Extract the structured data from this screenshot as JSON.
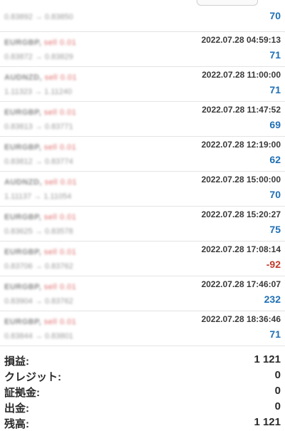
{
  "top": {
    "prices": "0.83892 → 0.83850",
    "profit": "70"
  },
  "trades": [
    {
      "symbol": "EURGBP,",
      "side": "sell 0.01",
      "prices": "0.83872 → 0.83829",
      "time": "2022.07.28 04:59:13",
      "profit": "71",
      "negative": false
    },
    {
      "symbol": "AUDNZD,",
      "side": "sell 0.01",
      "prices": "1.11323 → 1.11240",
      "time": "2022.07.28 11:00:00",
      "profit": "71",
      "negative": false
    },
    {
      "symbol": "EURGBP,",
      "side": "sell 0.01",
      "prices": "0.83813 → 0.83771",
      "time": "2022.07.28 11:47:52",
      "profit": "69",
      "negative": false
    },
    {
      "symbol": "EURGBP,",
      "side": "sell 0.01",
      "prices": "0.83812 → 0.83774",
      "time": "2022.07.28 12:19:00",
      "profit": "62",
      "negative": false
    },
    {
      "symbol": "AUDNZD,",
      "side": "sell 0.01",
      "prices": "1.11137 → 1.11054",
      "time": "2022.07.28 15:00:00",
      "profit": "70",
      "negative": false
    },
    {
      "symbol": "EURGBP,",
      "side": "sell 0.01",
      "prices": "0.83625 → 0.83578",
      "time": "2022.07.28 15:20:27",
      "profit": "75",
      "negative": false
    },
    {
      "symbol": "EURGBP,",
      "side": "sell 0.01",
      "prices": "0.83706 → 0.83762",
      "time": "2022.07.28 17:08:14",
      "profit": "-92",
      "negative": true
    },
    {
      "symbol": "EURGBP,",
      "side": "sell 0.01",
      "prices": "0.83904 → 0.83762",
      "time": "2022.07.28 17:46:07",
      "profit": "232",
      "negative": false
    },
    {
      "symbol": "EURGBP,",
      "side": "sell 0.01",
      "prices": "0.83844 → 0.83801",
      "time": "2022.07.28 18:36:46",
      "profit": "71",
      "negative": false
    }
  ],
  "summary": [
    {
      "label": "損益:",
      "value": "1 121"
    },
    {
      "label": "クレジット:",
      "value": "0"
    },
    {
      "label": "証拠金:",
      "value": "0"
    },
    {
      "label": "出金:",
      "value": "0"
    },
    {
      "label": "残高:",
      "value": "1 121"
    }
  ],
  "colors": {
    "profit_positive": "#1f6fb5",
    "profit_negative": "#c0392b",
    "sell_label": "#e06b6b"
  }
}
